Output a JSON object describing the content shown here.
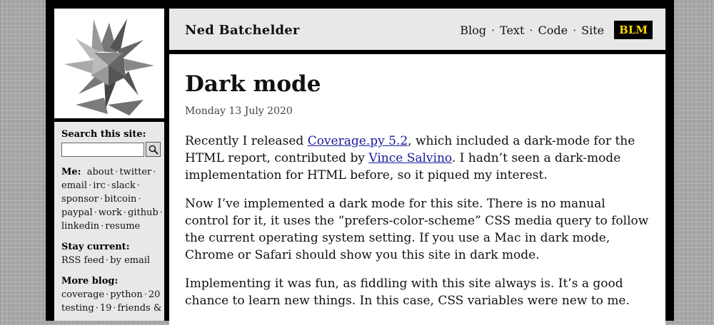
{
  "header": {
    "site_name": "Ned Batchelder",
    "nav": [
      "Blog",
      "Text",
      "Code",
      "Site"
    ],
    "blm_label": "BLM"
  },
  "post": {
    "title": "Dark mode",
    "date": "Monday 13 July 2020",
    "p1": {
      "t1": "Recently I released ",
      "link1": "Coverage.py 5.2",
      "t2": ", which included a dark-mode for the HTML report, contributed by ",
      "link2": "Vince Salvino",
      "t3": ". I hadn’t seen a dark-mode implementation for HTML before, so it piqued my interest."
    },
    "p2": "Now I’ve implemented a dark mode for this site. There is no manual control for it, it uses the “prefers-color-scheme” CSS media query to follow the current operating system setting. If you use a Mac in dark mode, Chrome or Safari should show you this site in dark mode.",
    "p3": "Implementing it was fun, as fiddling with this site always is. It’s a good chance to learn new things. In this case, CSS variables were new to me."
  },
  "sidebar": {
    "search_label": "Search this site:",
    "search_value": "",
    "me_label": "Me:",
    "me_links": [
      "about",
      "twitter",
      "email",
      "irc",
      "slack",
      "sponsor",
      "bitcoin",
      "paypal",
      "work",
      "github",
      "linkedin",
      "resume"
    ],
    "stay_label": "Stay current:",
    "stay_links": [
      "RSS feed",
      "by email"
    ],
    "more_label": "More blog:",
    "more_links": [
      "coverage",
      "python",
      "20",
      "testing",
      "19",
      "friends &"
    ]
  },
  "icons": {
    "logo": "stellated-star-logo-icon",
    "search": "magnifier-icon"
  },
  "colors": {
    "link": "#1a1a9e",
    "blm_bg": "#000000",
    "blm_text": "#ffd400",
    "panel": "#e8e8e8"
  }
}
